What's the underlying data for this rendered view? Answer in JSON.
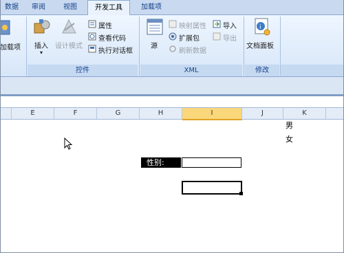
{
  "tabs": [
    "数据",
    "审阅",
    "视图",
    "开发工具",
    "加载项"
  ],
  "active_tab": "开发工具",
  "ribbon": {
    "addins_label": "加载项",
    "controls_group": {
      "title": "控件",
      "insert": "插入",
      "design_mode": "设计模式",
      "properties": "属性",
      "view_code": "查看代码",
      "run_dialog": "执行对话框"
    },
    "xml_group": {
      "title": "XML",
      "source": "源",
      "map_properties": "映射属性",
      "expansion_packs": "扩展包",
      "refresh_data": "刷新数据",
      "import": "导入",
      "export": "导出"
    },
    "modify_group": {
      "title": "修改",
      "document_panel": "文档面板"
    }
  },
  "columns": [
    "E",
    "F",
    "G",
    "H",
    "I",
    "J",
    "K"
  ],
  "selected_column": "I",
  "cells": {
    "k_male": "男",
    "k_female": "女",
    "gender_label": "性别:"
  }
}
